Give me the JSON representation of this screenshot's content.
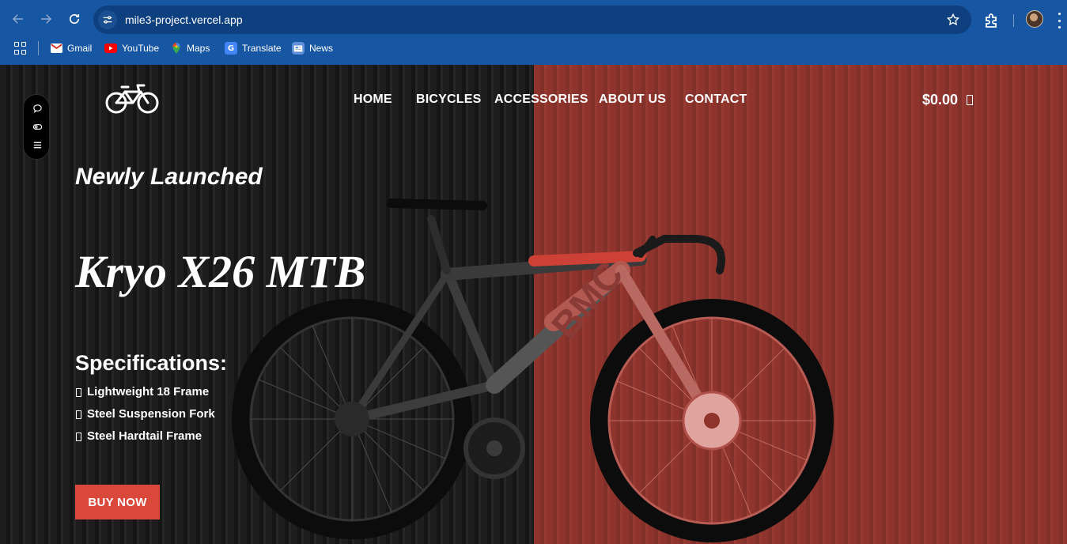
{
  "browser": {
    "url": "mile3-project.vercel.app",
    "bookmarks": [
      {
        "label": "Gmail",
        "icon": "gmail-icon",
        "color": "#d93025"
      },
      {
        "label": "YouTube",
        "icon": "youtube-icon",
        "color": "#ff0000"
      },
      {
        "label": "Maps",
        "icon": "maps-icon",
        "color": "#34a853"
      },
      {
        "label": "Translate",
        "icon": "translate-icon",
        "color": "#4285f4"
      },
      {
        "label": "News",
        "icon": "news-icon",
        "color": "#4285f4"
      }
    ],
    "colors": {
      "frame": "#1756a3",
      "omnibox": "#0e3f7e"
    }
  },
  "site": {
    "nav": {
      "home": "HOME",
      "bicycles": "BICYCLES",
      "accessories": "ACCESSORIES",
      "about": "ABOUT US",
      "contact": "CONTACT"
    },
    "cart_total": "$0.00",
    "hero": {
      "kicker": "Newly Launched",
      "product_name": "Kryo X26 MTB",
      "spec_heading": "Specifications:",
      "specs": [
        "Lightweight 18 Frame",
        "Steel Suspension Fork",
        "Steel Hardtail Frame"
      ],
      "cta": "BUY NOW"
    },
    "colors": {
      "accent": "#d9483b",
      "right_panel": "#8e342c"
    }
  }
}
